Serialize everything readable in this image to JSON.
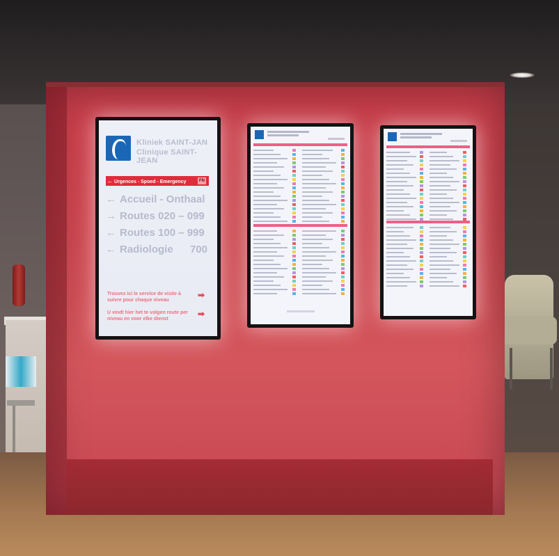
{
  "photo": {
    "subject": "hospital-wayfinding-kiosk",
    "kiosk_color": "#cd4750"
  },
  "screen1": {
    "brand_line1": "Kliniek SAINT-JAN",
    "brand_line2": "Clinique SAINT-JEAN",
    "emergency": {
      "arrow": "←",
      "label": "Urgences - Spoed - Emergency",
      "number": "FN"
    },
    "destinations": [
      {
        "arrow": "←",
        "label": "Accueil - Onthaal",
        "number": ""
      },
      {
        "arrow": "→",
        "label": "Routes 020 – 099",
        "number": ""
      },
      {
        "arrow": "←",
        "label": "Routes 100 – 999",
        "number": ""
      },
      {
        "arrow": "←",
        "label": "Radiologie",
        "number": "700"
      }
    ],
    "notices": [
      {
        "text": "Trouvez ici le service de visite à suivre pour chaque niveau",
        "arrow": "➡"
      },
      {
        "text": "U vindt hier het te volgen route per niveau en voor elke dienst",
        "arrow": "➡"
      }
    ]
  },
  "palette": [
    "#f07ab0",
    "#56b5e8",
    "#f3b23e",
    "#7dcc6b",
    "#b894dc",
    "#ee5f5f",
    "#6fd0c6",
    "#f6d24a"
  ]
}
